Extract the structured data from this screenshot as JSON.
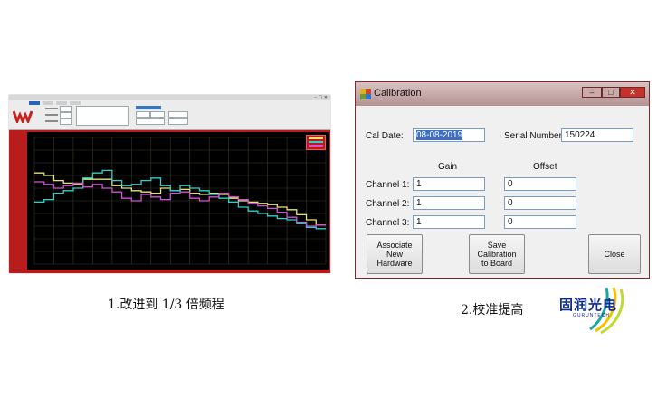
{
  "left_panel": {
    "caption": "1.改进到 1/3 倍频程",
    "chart_data": {
      "type": "line",
      "style": "step",
      "x": [
        1,
        2,
        3,
        4,
        5,
        6,
        7,
        8,
        9,
        10,
        11,
        12,
        13,
        14,
        15,
        16,
        17,
        18,
        19,
        20,
        21,
        22,
        23,
        24,
        25,
        26,
        27,
        28,
        29,
        30
      ],
      "ylim": [
        0,
        100
      ],
      "grid": true,
      "background": "#000000",
      "legend_placement": "top-right",
      "series": [
        {
          "color": "#e6e66e",
          "values": [
            72,
            70,
            66,
            64,
            63,
            67,
            67,
            67,
            62,
            60,
            58,
            57,
            56,
            60,
            58,
            59,
            56,
            55,
            56,
            55,
            52,
            50,
            49,
            48,
            47,
            45,
            43,
            39,
            35,
            31
          ]
        },
        {
          "color": "#2fd2c8",
          "values": [
            49,
            51,
            56,
            58,
            60,
            68,
            72,
            74,
            66,
            62,
            63,
            66,
            68,
            62,
            58,
            62,
            60,
            58,
            55,
            52,
            49,
            45,
            42,
            40,
            38,
            36,
            35,
            32,
            29,
            28
          ]
        },
        {
          "color": "#d94fd9",
          "values": [
            65,
            63,
            60,
            62,
            64,
            61,
            63,
            60,
            57,
            52,
            50,
            55,
            53,
            51,
            56,
            57,
            52,
            50,
            53,
            56,
            53,
            51,
            48,
            46,
            44,
            41,
            37,
            33,
            30,
            31
          ]
        }
      ]
    }
  },
  "right_panel": {
    "caption": "2.校准提高",
    "dialog": {
      "title": "Calibration",
      "title_buttons": {
        "minimize": "–",
        "maximize": "□",
        "close": "✕"
      },
      "cal_date_label": "Cal Date:",
      "cal_date_value": "08-08-2019",
      "serial_label": "Serial Number:",
      "serial_value": "150224",
      "gain_header": "Gain",
      "offset_header": "Offset",
      "channels": [
        {
          "label": "Channel 1:",
          "gain": "1",
          "offset": "0"
        },
        {
          "label": "Channel 2:",
          "gain": "1",
          "offset": "0"
        },
        {
          "label": "Channel 3:",
          "gain": "1",
          "offset": "0"
        }
      ],
      "buttons": {
        "associate": "Associate\nNew\nHardware",
        "save": "Save\nCalibration\nto Board",
        "close": "Close"
      }
    }
  },
  "brand": {
    "name": "固润光电",
    "subtitle": "GURUNTECH",
    "colors": [
      "#0e2a88",
      "#f2c200",
      "#18a8a0",
      "#c0d830"
    ]
  }
}
